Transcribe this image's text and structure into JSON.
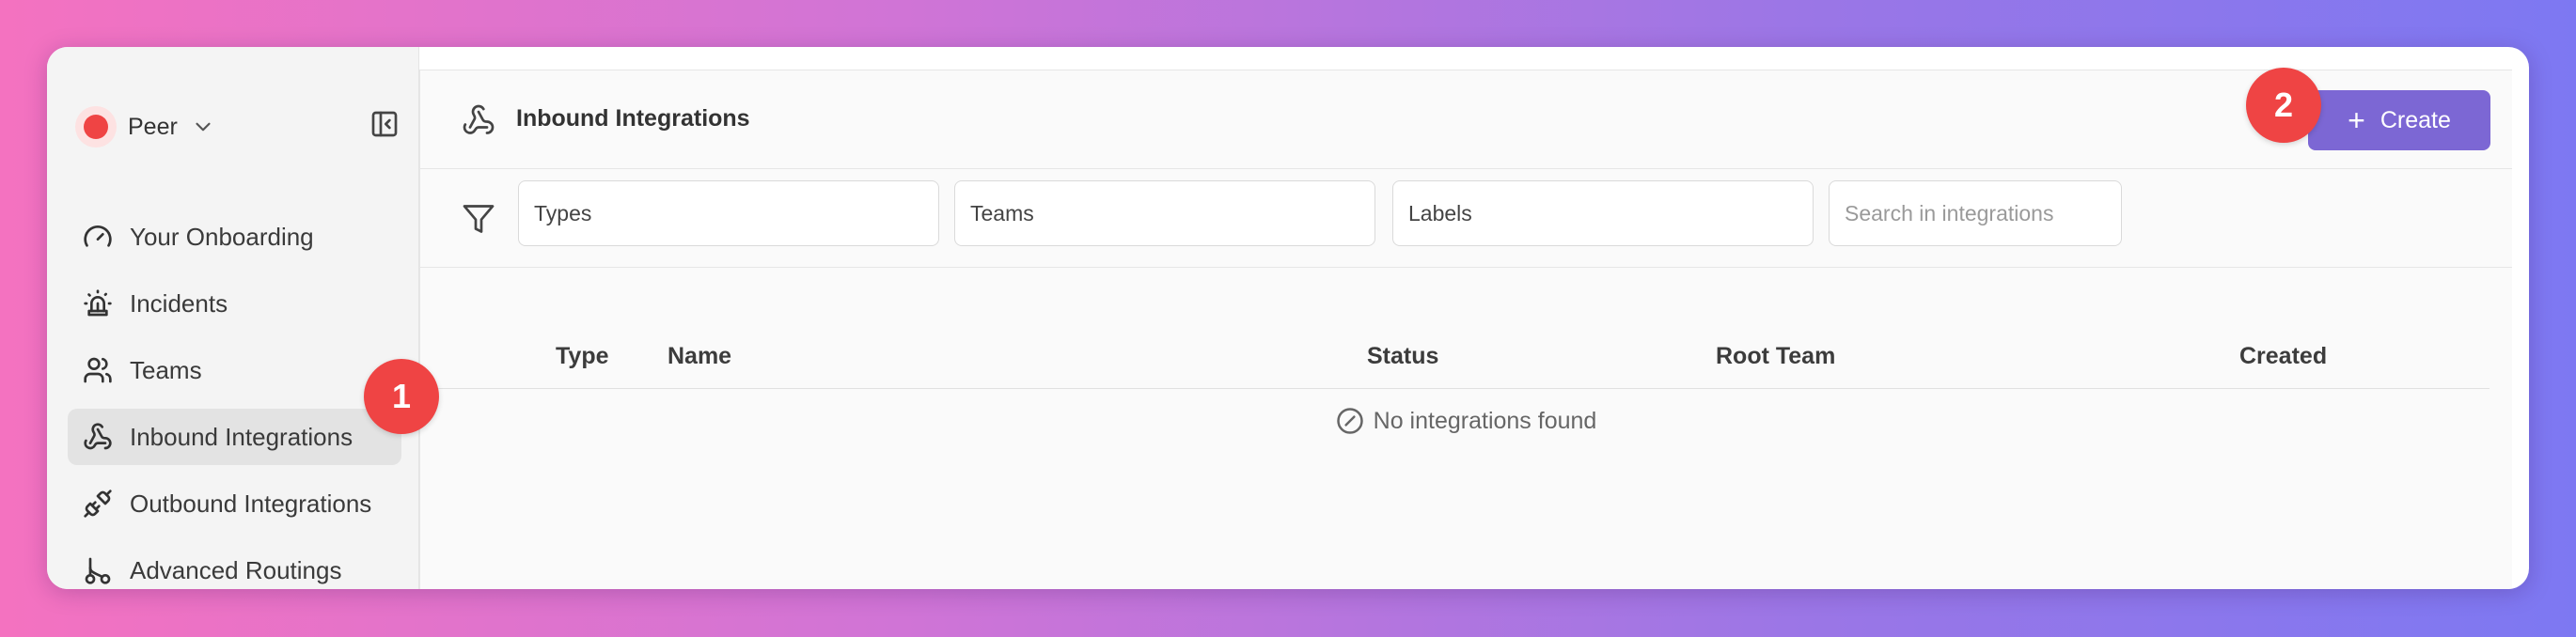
{
  "workspace": {
    "name": "Peer",
    "color": "#ef4444"
  },
  "sidebar": {
    "items": [
      {
        "label": "Your Onboarding",
        "icon": "gauge-icon"
      },
      {
        "label": "Incidents",
        "icon": "siren-icon"
      },
      {
        "label": "Teams",
        "icon": "users-icon"
      },
      {
        "label": "Inbound Integrations",
        "icon": "webhook-icon",
        "active": true
      },
      {
        "label": "Outbound Integrations",
        "icon": "plug-icon"
      },
      {
        "label": "Advanced Routings",
        "icon": "route-icon"
      }
    ]
  },
  "header": {
    "title": "Inbound Integrations",
    "create_label": "Create"
  },
  "filters": {
    "types": "Types",
    "teams": "Teams",
    "labels": "Labels",
    "search_placeholder": "Search in integrations"
  },
  "table": {
    "columns": [
      "Type",
      "Name",
      "Status",
      "Root Team",
      "Created"
    ],
    "empty_message": "No integrations found"
  },
  "annotations": [
    "1",
    "2"
  ],
  "colors": {
    "accent": "#7c67d4",
    "badge": "#ef4444"
  }
}
